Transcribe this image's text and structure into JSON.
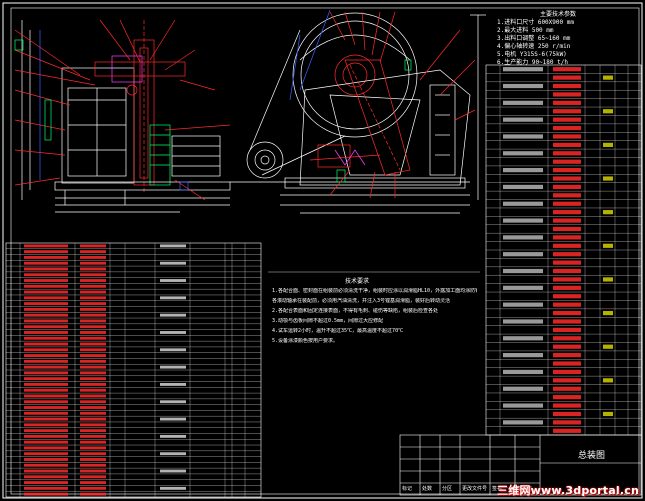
{
  "colors": {
    "background": "#000000",
    "line_red": "#ff2a2a",
    "line_white": "#ffffff",
    "line_green": "#00ff66",
    "line_blue": "#3a64ff",
    "line_magenta": "#ff40ff",
    "line_cyan": "#00e5ff",
    "text_yellow": "#ffff00"
  },
  "spec_block": {
    "heading": "主要技术参数",
    "lines": [
      "1.进料口尺寸  600X900  mm",
      "2.最大进料  500  mm",
      "3.出料口调整  65~160  mm",
      "4.偏心轴转速  250  r/min",
      "5.电机  Y315S-6(75kW)",
      "6.生产能力  90~180  t/h"
    ]
  },
  "tech_notes": {
    "heading": "技术要求",
    "lines": [
      "1.各配合面、密封面在组装前必须清洗干净，组装时应涂以润滑脂HL10，外露加工面均涂防锈油",
      "   各滚动轴承在装配前，必须用汽油清洗，并注入3号锂基润滑脂，装好后转动灵活",
      "2.各配合表面和固定连接表面，不得有毛刺、碰伤等缺陷，组装后检查各处",
      "3.动颚与齿板间隙不超过0.5mm，间隙过大应修配",
      "4.试车运转2小时，温升不超过35℃，最高温度不超过70℃",
      "5.设备涂漆颜色按用户要求。"
    ]
  },
  "title_block": {
    "cells": [
      "标记",
      "处数",
      "分区",
      "更改文件号",
      "签名",
      "年月日"
    ],
    "drawing_title": "总装图"
  },
  "watermark": "三维网www.3dportal.cn",
  "bom_left_rows": 44,
  "bom_right_rows": 44
}
